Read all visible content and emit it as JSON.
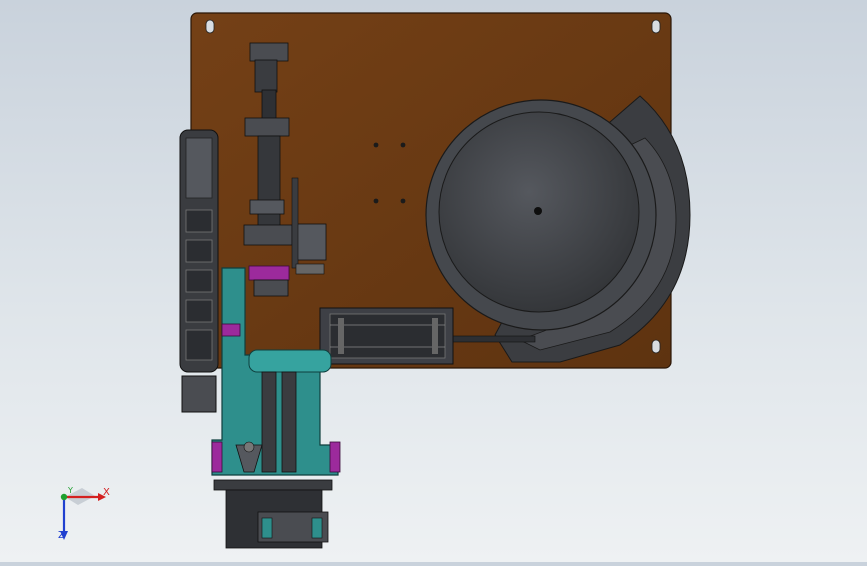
{
  "window": {
    "title": ""
  },
  "triad": {
    "x_label": "X",
    "y_label": "Y",
    "z_label": "Z"
  },
  "colors": {
    "background_top": "#c9d2dc",
    "background_bottom": "#eef1f3",
    "base_plate": "#6b3a12",
    "bowl_dark": "#3a3c40",
    "bowl_mid": "#4a4d52",
    "frame_teal": "#2e8f8c",
    "accent_magenta": "#9c2a9c",
    "axis_x": "#d42020",
    "axis_y": "#20a030",
    "axis_z": "#2040d0"
  }
}
